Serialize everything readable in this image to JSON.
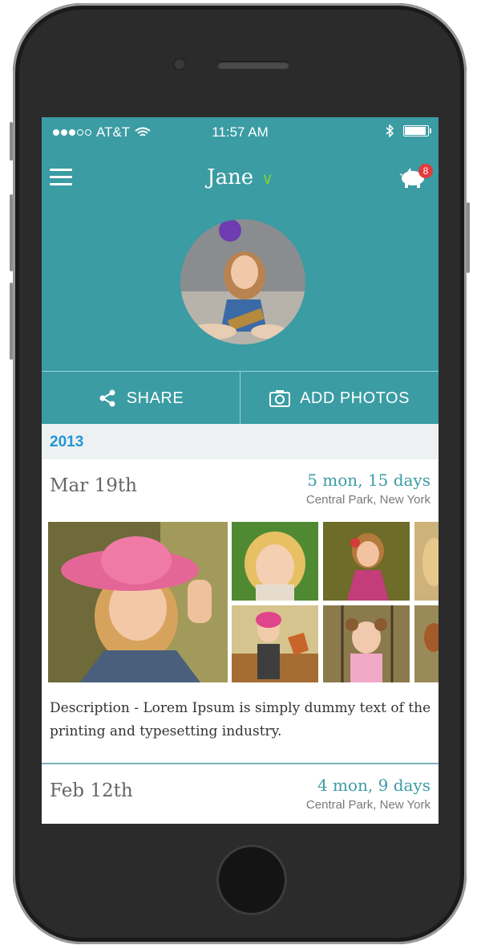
{
  "status_bar": {
    "carrier": "AT&T",
    "time": "11:57 AM"
  },
  "header": {
    "child_name": "Jane",
    "chevron_icon": "chevron-down-icon",
    "notification_count": "8"
  },
  "actions": {
    "share_label": "SHARE",
    "add_photos_label": "ADD PHOTOS"
  },
  "timeline": {
    "year": "2013",
    "entries": [
      {
        "date": "Mar 19th",
        "age": "5 mon, 15 days",
        "location": "Central Park, New York",
        "description": "Description - Lorem Ipsum is simply dummy text of the printing and typesetting industry."
      },
      {
        "date": "Feb 12th",
        "age": "4 mon, 9 days",
        "location": "Central Park, New York"
      }
    ]
  },
  "colors": {
    "accent": "#3b9ca3",
    "year_blue": "#2296d9",
    "badge_red": "#e23b3b",
    "chevron_green": "#7bd23a"
  }
}
